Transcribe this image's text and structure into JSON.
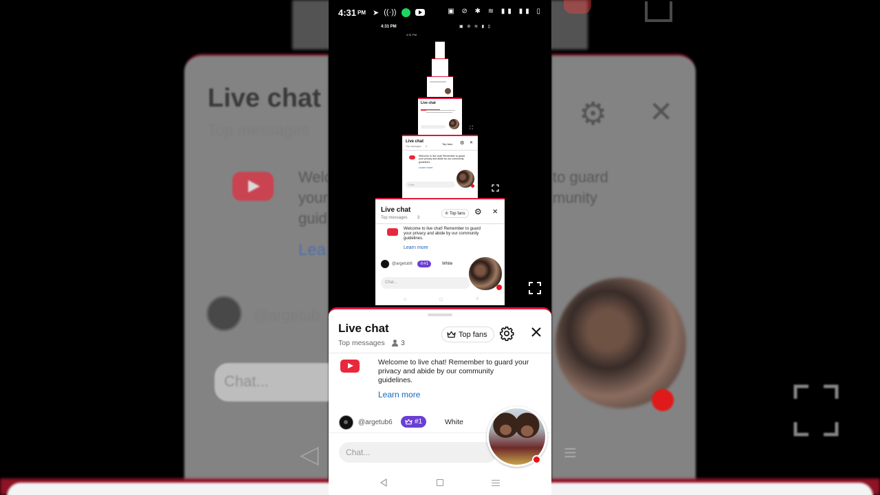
{
  "background": {
    "title": "Live chat",
    "subtitle": "Top messages",
    "welcome_fragment_left": "Welc\nyour\nguid",
    "welcome_fragment_right": "to guard\nmunity",
    "learn_fragment": "Lea",
    "handle_fragment": "@argetub",
    "chat_placeholder": "Chat..."
  },
  "status_bar": {
    "time": "4:31",
    "ampm": "PM",
    "mini_time": "4:31 PM",
    "micro_time": "4:31 PM"
  },
  "nested_frames": [
    {
      "title": "Live chat",
      "subtitle": "Top messages",
      "viewers": "3",
      "top_fans": "Top fans",
      "welcome": "Welcome to live chat! Remember to guard your privacy and abide by our community guidelines.",
      "learn_more": "Learn more",
      "handle": "@argetub6",
      "rank": "#1",
      "ticker_text": "White",
      "chat_placeholder": "Chat..."
    },
    {
      "title": "Live chat",
      "subtitle": "Top messages",
      "viewers": "3",
      "top_fans": "Top fans",
      "welcome": "Welcome to live chat! Remember to guard your privacy and abide by our community guidelines.",
      "learn_more": "Learn more",
      "chat_placeholder": "Chat"
    },
    {
      "title": "Live chat"
    }
  ],
  "chat": {
    "title": "Live chat",
    "subtitle": "Top messages",
    "viewer_count": "3",
    "top_fans_label": "Top fans",
    "welcome_message": "Welcome to live chat! Remember to guard your privacy and abide by our community guidelines.",
    "learn_more": "Learn more",
    "ticker": {
      "handle": "@argetub6",
      "rank": "#1",
      "text": "White"
    },
    "chat_placeholder": "Chat..."
  },
  "icons": {
    "settings": "gear-icon",
    "close": "close-icon",
    "crown": "crown-icon",
    "viewers": "person-icon",
    "expand": "fullscreen-icon",
    "youtube": "youtube-logo-icon"
  },
  "colors": {
    "accent_red": "#e0163a",
    "youtube_red": "#e8283d",
    "rank_purple": "#6b3fd4",
    "link_blue": "#1565c0",
    "record_red": "#e8141b"
  }
}
